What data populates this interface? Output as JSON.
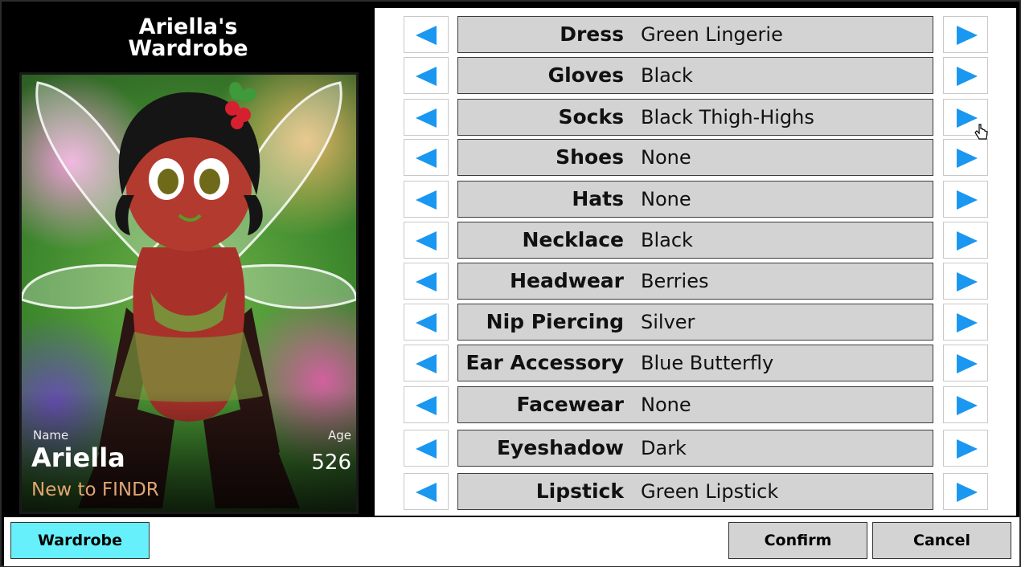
{
  "card": {
    "title_line1": "Ariella's",
    "title_line2": "Wardrobe",
    "name_label": "Name",
    "name": "Ariella",
    "age_label": "Age",
    "age": "526",
    "status": "New to FINDR"
  },
  "options": [
    {
      "category": "Dress",
      "value": "Green Lingerie"
    },
    {
      "category": "Gloves",
      "value": "Black"
    },
    {
      "category": "Socks",
      "value": "Black Thigh-Highs"
    },
    {
      "category": "Shoes",
      "value": "None"
    },
    {
      "category": "Hats",
      "value": "None"
    },
    {
      "category": "Necklace",
      "value": "Black"
    },
    {
      "category": "Headwear",
      "value": "Berries"
    },
    {
      "category": "Nip Piercing",
      "value": "Silver"
    },
    {
      "category": "Ear Accessory",
      "value": "Blue Butterfly"
    },
    {
      "category": "Facewear",
      "value": "None"
    },
    {
      "category": "Eyeshadow",
      "value": "Dark"
    },
    {
      "category": "Lipstick",
      "value": "Green Lipstick"
    }
  ],
  "buttons": {
    "wardrobe": "Wardrobe",
    "confirm": "Confirm",
    "cancel": "Cancel"
  },
  "colors": {
    "arrow": "#1a97f0",
    "wardrobe_button": "#66f0fb",
    "option_bar": "#d3d3d3",
    "status_text": "#e3a470"
  },
  "icons": {
    "prev": "left-arrow-icon",
    "next": "right-arrow-icon",
    "cursor": "hand-cursor-icon"
  }
}
